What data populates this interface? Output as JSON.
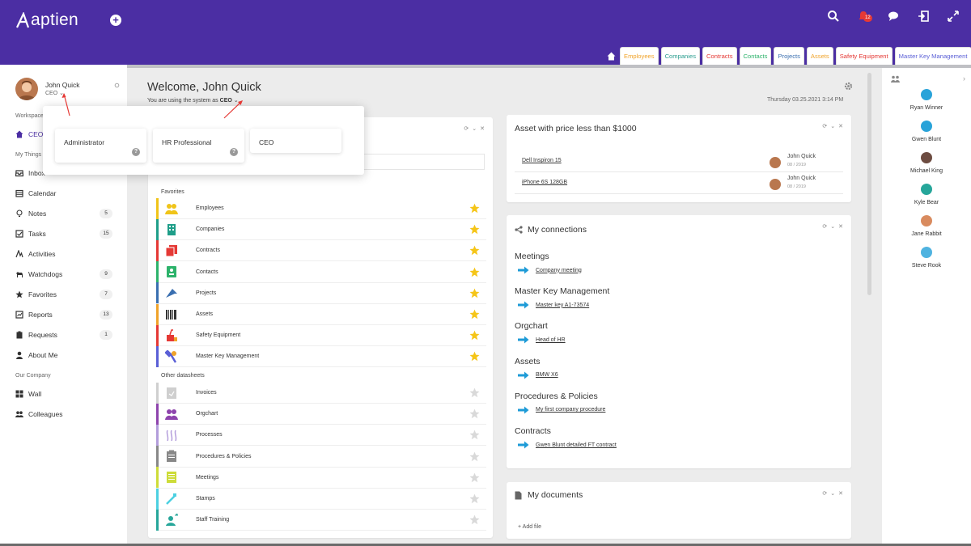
{
  "app": {
    "logo_text": "aptien",
    "notification_count": "12"
  },
  "tabs": [
    {
      "label": "Employees",
      "color": "#f0a32a"
    },
    {
      "label": "Companies",
      "color": "#2a9d8f"
    },
    {
      "label": "Contracts",
      "color": "#e53935"
    },
    {
      "label": "Contacts",
      "color": "#2db36b"
    },
    {
      "label": "Projects",
      "color": "#3a6fb0"
    },
    {
      "label": "Assets",
      "color": "#f0a32a"
    },
    {
      "label": "Safety Equipment",
      "color": "#e53935"
    },
    {
      "label": "Master Key Management",
      "color": "#5a5fd6"
    }
  ],
  "user": {
    "name": "John Quick",
    "role": "CEO"
  },
  "sidebar": {
    "workspace_label": "Workspace",
    "workspace_item": "CEO",
    "mythings_label": "My Things",
    "items": [
      {
        "label": "Inbox",
        "count": "",
        "icon": "inbox-icon"
      },
      {
        "label": "Calendar",
        "count": "",
        "icon": "calendar-icon"
      },
      {
        "label": "Notes",
        "count": "5",
        "icon": "bulb-icon"
      },
      {
        "label": "Tasks",
        "count": "15",
        "icon": "check-icon"
      },
      {
        "label": "Activities",
        "count": "",
        "icon": "activity-icon"
      },
      {
        "label": "Watchdogs",
        "count": "9",
        "icon": "dog-icon"
      },
      {
        "label": "Favorites",
        "count": "7",
        "icon": "star-icon"
      },
      {
        "label": "Reports",
        "count": "13",
        "icon": "chart-icon"
      },
      {
        "label": "Requests",
        "count": "1",
        "icon": "request-icon"
      },
      {
        "label": "About Me",
        "count": "",
        "icon": "person-icon"
      }
    ],
    "company_label": "Our Company",
    "company_items": [
      {
        "label": "Wall",
        "icon": "grid-icon"
      },
      {
        "label": "Colleagues",
        "icon": "people-icon"
      }
    ]
  },
  "main": {
    "welcome": "Welcome, John Quick",
    "sub_prefix": "You are using the system as",
    "sub_role": "CEO",
    "date": "Thursday 03.25.2021 3:14 PM"
  },
  "favorites": {
    "favorites_label": "Favorites",
    "items": [
      {
        "label": "Employees",
        "color": "#f0c419"
      },
      {
        "label": "Companies",
        "color": "#1f9e89"
      },
      {
        "label": "Contracts",
        "color": "#e53935"
      },
      {
        "label": "Contacts",
        "color": "#2db36b"
      },
      {
        "label": "Projects",
        "color": "#3a6fb0"
      },
      {
        "label": "Assets",
        "color": "#f0a32a"
      },
      {
        "label": "Safety Equipment",
        "color": "#e53935"
      },
      {
        "label": "Master Key Management",
        "color": "#5a5fd6"
      }
    ],
    "other_label": "Other datasheets",
    "other_items": [
      {
        "label": "Invoices",
        "color": "#cfcfcf"
      },
      {
        "label": "Orgchart",
        "color": "#8e44ad"
      },
      {
        "label": "Processes",
        "color": "#b39ddb"
      },
      {
        "label": "Procedures & Policies",
        "color": "#888888"
      },
      {
        "label": "Meetings",
        "color": "#cddc39"
      },
      {
        "label": "Stamps",
        "color": "#4dd0e1"
      },
      {
        "label": "Staff Training",
        "color": "#26a69a"
      }
    ]
  },
  "assets_card": {
    "title": "Asset with price less than $1000",
    "rows": [
      {
        "name": "Dell Inspiron 15",
        "owner": "John Quick",
        "date": "08 / 2019"
      },
      {
        "name": "iPhone 6S 128GB",
        "owner": "John Quick",
        "date": "08 / 2019"
      }
    ]
  },
  "connections": {
    "title": "My connections",
    "groups": [
      {
        "head": "Meetings",
        "item": "Company meeting"
      },
      {
        "head": "Master Key Management",
        "item": "Master key A1-73574"
      },
      {
        "head": "Orgchart",
        "item": "Head of HR"
      },
      {
        "head": "Assets",
        "item": "BMW X6"
      },
      {
        "head": "Procedures & Policies",
        "item": "My first company procedure"
      },
      {
        "head": "Contracts",
        "item": "Gwen Blunt detailed FT contract"
      }
    ]
  },
  "documents": {
    "title": "My documents",
    "add_file": "Add file"
  },
  "people": [
    {
      "name": "Ryan Winner",
      "color": "#29a3d9"
    },
    {
      "name": "Gwen Blunt",
      "color": "#29a3d9"
    },
    {
      "name": "Michael King",
      "color": "#6d4c41"
    },
    {
      "name": "Kyle Bear",
      "color": "#26a69a"
    },
    {
      "name": "Jane Rabbit",
      "color": "#d98b5f"
    },
    {
      "name": "Steve Rook",
      "color": "#4fb3e0"
    }
  ],
  "role_popup": {
    "roles": [
      "Administrator",
      "HR Professional",
      "CEO"
    ]
  }
}
